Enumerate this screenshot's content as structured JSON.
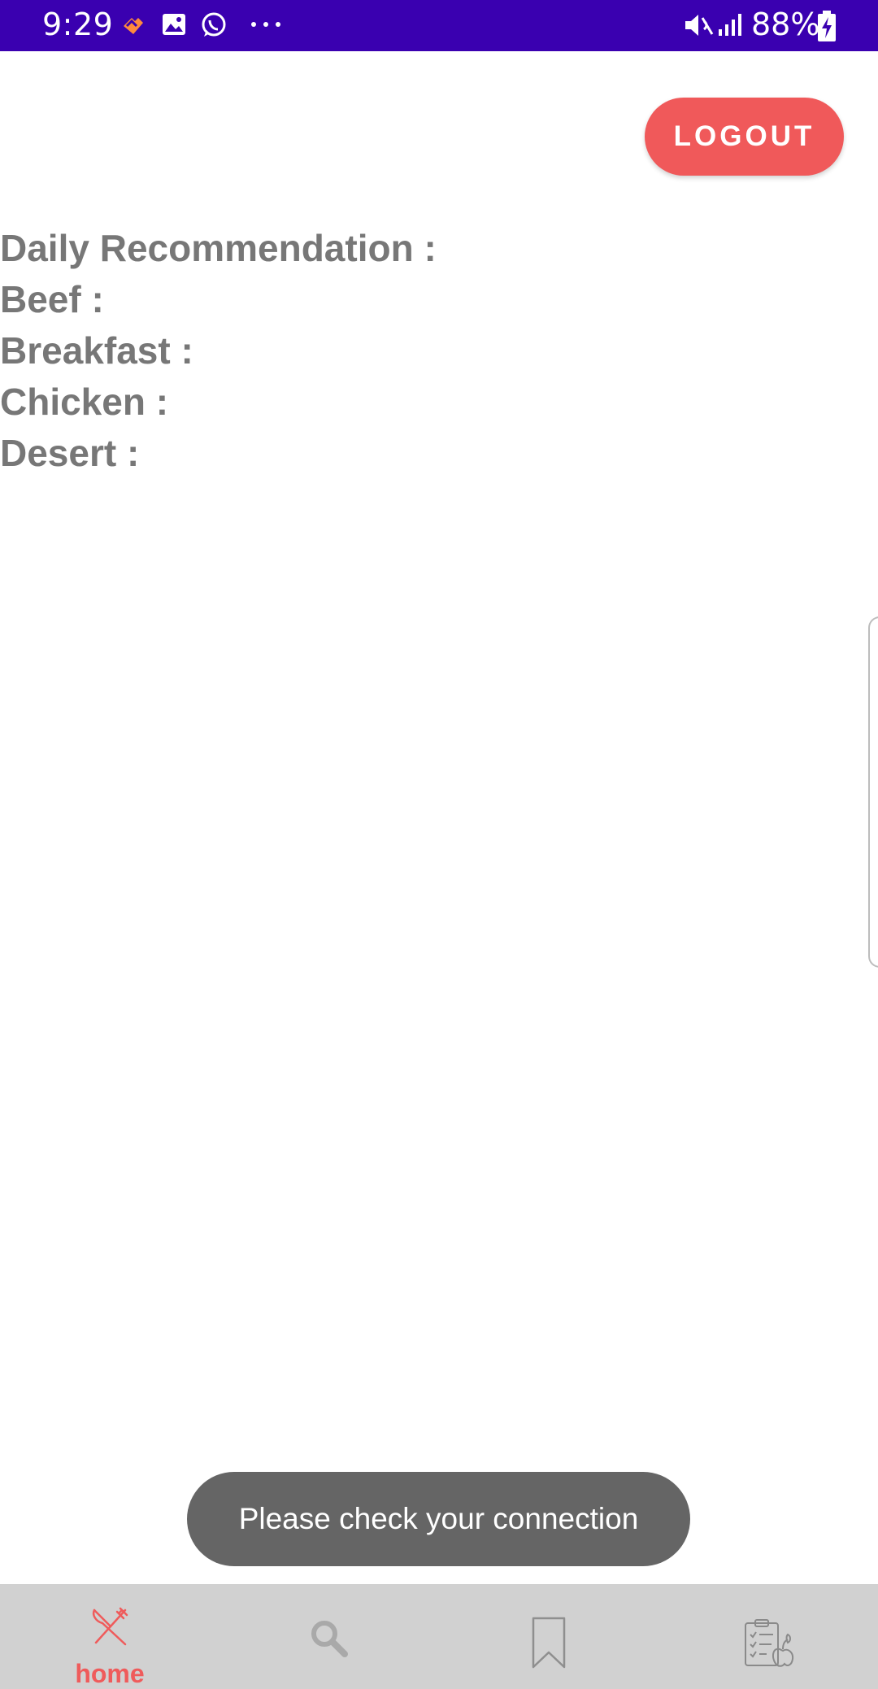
{
  "status_bar": {
    "time": "9:29",
    "battery": "88%",
    "icons": [
      "heart-app-icon",
      "gallery-icon",
      "whatsapp-icon",
      "more-dots-icon",
      "mute-icon",
      "signal-icon",
      "battery-charging-icon"
    ]
  },
  "header": {
    "logout_label": "LOGOUT"
  },
  "recommendations": {
    "items": [
      "Daily Recommendation :",
      "Beef :",
      "Breakfast :",
      "Chicken :",
      "Desert :"
    ]
  },
  "toast": {
    "message": "Please check your connection"
  },
  "bottom_nav": {
    "items": [
      {
        "icon": "fork-knife-icon",
        "label": "home",
        "active": true
      },
      {
        "icon": "search-icon",
        "label": "",
        "active": false
      },
      {
        "icon": "bookmark-icon",
        "label": "",
        "active": false
      },
      {
        "icon": "diet-plan-icon",
        "label": "",
        "active": false
      }
    ]
  },
  "colors": {
    "status_bar": "#3a00b0",
    "accent": "#f0595a",
    "label_text": "#777777",
    "toast_bg": "#656565",
    "nav_bg": "#d1d1d1"
  }
}
